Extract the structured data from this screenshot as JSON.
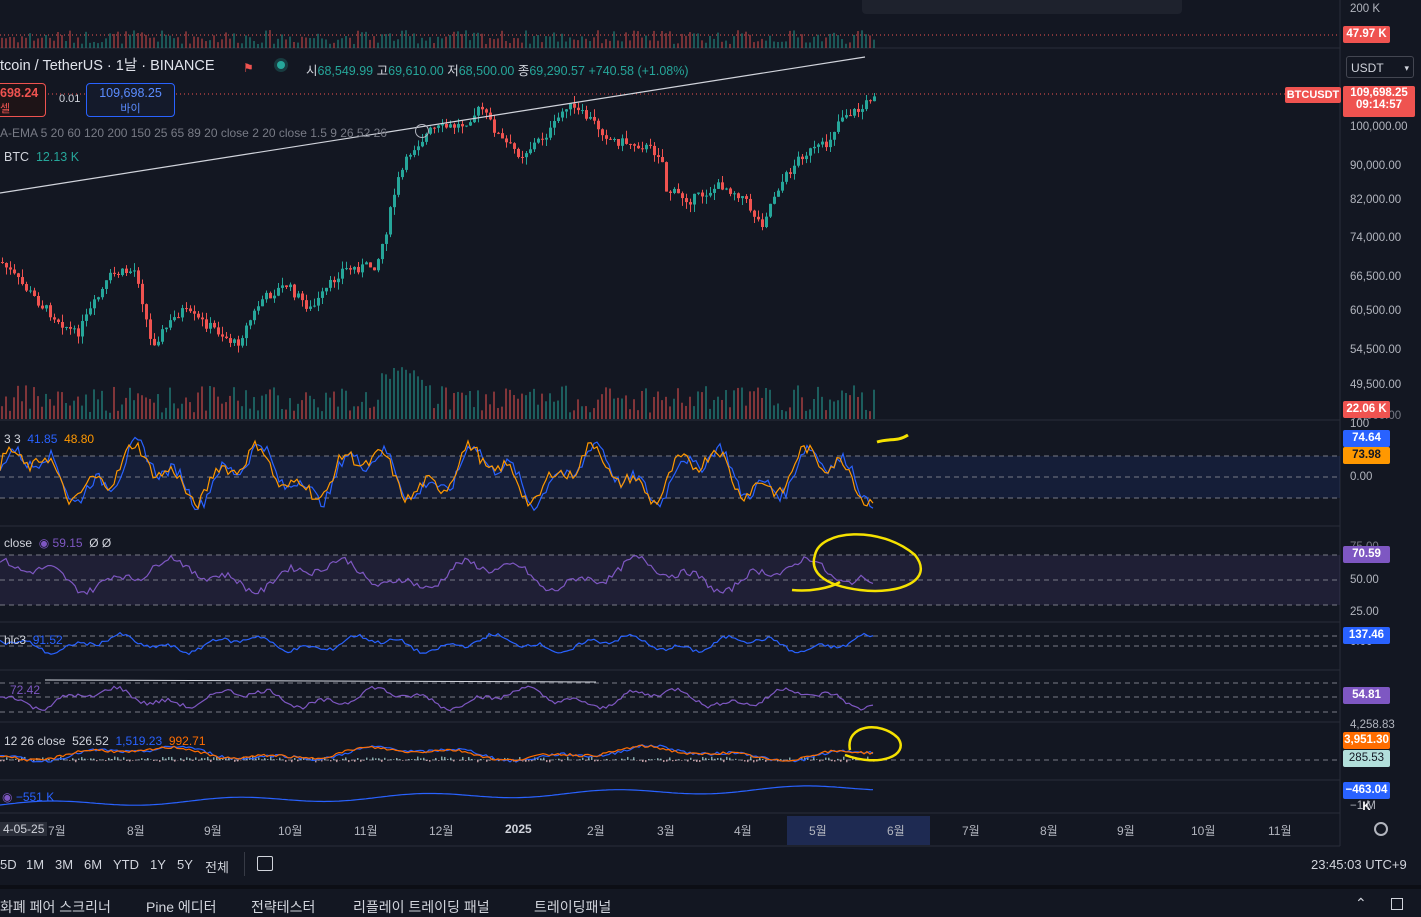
{
  "header": {
    "symbol_title": "tcoin / TetherUS · 1날 · BINANCE",
    "ohlc": {
      "open_label": "시",
      "open": "68,549.99",
      "high_label": "고",
      "high": "69,610.00",
      "low_label": "저",
      "low": "68,500.00",
      "close_label": "종",
      "close": "69,290.57",
      "change": "+740.58 (+1.08%)"
    },
    "sell_price": "698.24",
    "sell_label": "셀",
    "spread": "0.01",
    "buy_price": "109,698.25",
    "buy_label": "바이",
    "ema_legend": "A-EMA 5 20 60 120 200 150 25 65 89 20 close 2 20 close 1.5 9 26 52 26",
    "volume_legend": "BTC",
    "volume_value": "12.13 K",
    "currency_select": "USDT"
  },
  "price_axis": {
    "ticks": [
      "100,000.00",
      "90,000.00",
      "82,000.00",
      "74,000.00",
      "66,500.00",
      "60,500.00",
      "54,500.00",
      "49,500.00"
    ],
    "top_ticks": [
      "200 K"
    ],
    "current_symbol": "BTCUSDT",
    "current_price": "109,698.25",
    "countdown": "09:14:57",
    "volume_badge": "22.06 K",
    "top_volume_badge": "47.97 K",
    "volume_bottom_tick": "43,000.00"
  },
  "panes": {
    "stoch": {
      "legend": "3 3",
      "k": "41.85",
      "d": "48.80",
      "badge_k": "74.64",
      "badge_d": "73.98",
      "ticks": [
        "100",
        "0.00"
      ]
    },
    "rsi": {
      "legend": "close",
      "value": "59.15",
      "extra": "Ø Ø",
      "badge": "70.59",
      "ticks": [
        "75.00",
        "50.00",
        "25.00"
      ]
    },
    "cci": {
      "legend": "hlc3",
      "value": "91.52",
      "badge": "137.46",
      "ticks": [
        "0.00"
      ]
    },
    "mfi": {
      "legend": "",
      "value": "72.42",
      "badge": "54.81"
    },
    "macd": {
      "legend": "12 26 close",
      "hist": "526.52",
      "macd": "1,519.23",
      "signal": "992.71",
      "badge_top": "4,258.83",
      "badge_signal": "3,951.30",
      "badge_hist": "285.53"
    },
    "obv": {
      "value": "−551 K",
      "badge": "−463.04 K",
      "tick": "−1 M"
    }
  },
  "time_axis": {
    "start_date": "4-05-25",
    "months": [
      "7월",
      "8월",
      "9월",
      "10월",
      "11월",
      "12월",
      "2025",
      "2월",
      "3월",
      "4월",
      "5월",
      "6월",
      "7월",
      "8월",
      "9월",
      "10월",
      "11월"
    ]
  },
  "toolbar": {
    "ranges": [
      "5D",
      "1M",
      "3M",
      "6M",
      "YTD",
      "1Y",
      "5Y",
      "전체"
    ],
    "clock": "23:45:03 UTC+9"
  },
  "bottom_tabs": [
    "화폐 페어 스크리너",
    "Pine 에디터",
    "전략테스터",
    "리플레이 트레이딩 패널",
    "트레이딩패널"
  ],
  "colors": {
    "background": "#131722",
    "up": "#26a69a",
    "down": "#ef5350",
    "accent": "#2962ff",
    "annotation": "#f5e100"
  }
}
